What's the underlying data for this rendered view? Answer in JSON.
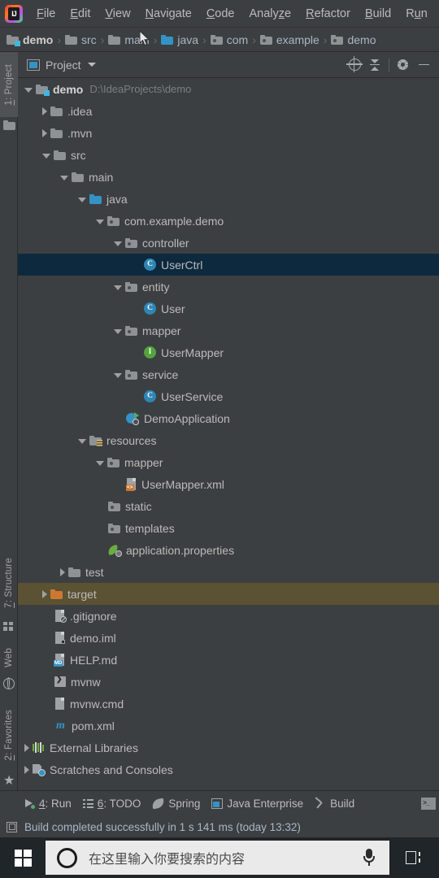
{
  "app": {
    "logo_icon": "intellij-idea-logo",
    "menu": [
      {
        "label": "File",
        "mnemonic": "F"
      },
      {
        "label": "Edit",
        "mnemonic": "E"
      },
      {
        "label": "View",
        "mnemonic": "V"
      },
      {
        "label": "Navigate",
        "mnemonic": "N"
      },
      {
        "label": "Code",
        "mnemonic": "C"
      },
      {
        "label": "Analyze",
        "mnemonic": "z"
      },
      {
        "label": "Refactor",
        "mnemonic": "R"
      },
      {
        "label": "Build",
        "mnemonic": "B"
      },
      {
        "label": "Run",
        "mnemonic": "u"
      }
    ]
  },
  "breadcrumb": {
    "separator": "›",
    "items": [
      {
        "label": "demo",
        "icon": "module-folder-icon",
        "root": true
      },
      {
        "label": "src",
        "icon": "folder-icon"
      },
      {
        "label": "main",
        "icon": "folder-icon"
      },
      {
        "label": "java",
        "icon": "source-root-folder-icon"
      },
      {
        "label": "com",
        "icon": "package-folder-icon"
      },
      {
        "label": "example",
        "icon": "package-folder-icon"
      },
      {
        "label": "demo",
        "icon": "package-folder-icon"
      }
    ]
  },
  "stripe": {
    "left": [
      {
        "label": "1: Project",
        "mnemonic": "1",
        "icon": "project-folder-icon",
        "active": true
      },
      {
        "label": "7: Structure",
        "mnemonic": "7",
        "icon": "structure-icon",
        "active": false
      },
      {
        "label": "Web",
        "mnemonic": "",
        "icon": "web-globe-icon",
        "active": false
      },
      {
        "label": "2: Favorites",
        "mnemonic": "2",
        "icon": "star-icon",
        "active": false
      }
    ]
  },
  "panel": {
    "title": "Project",
    "view_icon": "project-view-icon",
    "dropdown_icon": "chevron-down-icon",
    "tools": [
      {
        "name": "scroll-from-source-icon",
        "title": "Select Opened File"
      },
      {
        "name": "collapse-all-icon",
        "title": "Collapse All"
      },
      {
        "name": "gear-icon",
        "title": "Settings"
      },
      {
        "name": "minimize-icon",
        "title": "Hide"
      }
    ]
  },
  "tree": {
    "rows": [
      {
        "label": "demo",
        "sub": "D:\\IdeaProjects\\demo",
        "indent": 0,
        "arrow": "down",
        "icon": "module-folder-icon",
        "bold": true,
        "state": "normal"
      },
      {
        "label": ".idea",
        "sub": "",
        "indent": 1,
        "arrow": "right",
        "icon": "folder-icon",
        "bold": false,
        "state": "normal"
      },
      {
        "label": ".mvn",
        "sub": "",
        "indent": 1,
        "arrow": "right",
        "icon": "folder-icon",
        "bold": false,
        "state": "normal"
      },
      {
        "label": "src",
        "sub": "",
        "indent": 1,
        "arrow": "down",
        "icon": "folder-icon",
        "bold": false,
        "state": "normal"
      },
      {
        "label": "main",
        "sub": "",
        "indent": 2,
        "arrow": "down",
        "icon": "folder-icon",
        "bold": false,
        "state": "normal"
      },
      {
        "label": "java",
        "sub": "",
        "indent": 3,
        "arrow": "down",
        "icon": "source-root-folder-icon",
        "bold": false,
        "state": "normal"
      },
      {
        "label": "com.example.demo",
        "sub": "",
        "indent": 4,
        "arrow": "down",
        "icon": "package-folder-icon",
        "bold": false,
        "state": "normal"
      },
      {
        "label": "controller",
        "sub": "",
        "indent": 5,
        "arrow": "down",
        "icon": "package-folder-icon",
        "bold": false,
        "state": "normal"
      },
      {
        "label": "UserCtrl",
        "sub": "",
        "indent": 6,
        "arrow": "none",
        "icon": "java-class-icon",
        "bold": false,
        "state": "selected"
      },
      {
        "label": "entity",
        "sub": "",
        "indent": 5,
        "arrow": "down",
        "icon": "package-folder-icon",
        "bold": false,
        "state": "normal"
      },
      {
        "label": "User",
        "sub": "",
        "indent": 6,
        "arrow": "none",
        "icon": "java-class-icon",
        "bold": false,
        "state": "normal"
      },
      {
        "label": "mapper",
        "sub": "",
        "indent": 5,
        "arrow": "down",
        "icon": "package-folder-icon",
        "bold": false,
        "state": "normal"
      },
      {
        "label": "UserMapper",
        "sub": "",
        "indent": 6,
        "arrow": "none",
        "icon": "java-interface-icon",
        "bold": false,
        "state": "normal"
      },
      {
        "label": "service",
        "sub": "",
        "indent": 5,
        "arrow": "down",
        "icon": "package-folder-icon",
        "bold": false,
        "state": "normal"
      },
      {
        "label": "UserService",
        "sub": "",
        "indent": 6,
        "arrow": "none",
        "icon": "java-class-icon",
        "bold": false,
        "state": "normal"
      },
      {
        "label": "DemoApplication",
        "sub": "",
        "indent": 5,
        "arrow": "none",
        "icon": "spring-boot-application-icon",
        "bold": false,
        "state": "normal"
      },
      {
        "label": "resources",
        "sub": "",
        "indent": 3,
        "arrow": "down",
        "icon": "resource-root-folder-icon",
        "bold": false,
        "state": "normal"
      },
      {
        "label": "mapper",
        "sub": "",
        "indent": 4,
        "arrow": "down",
        "icon": "package-folder-icon",
        "bold": false,
        "state": "normal"
      },
      {
        "label": "UserMapper.xml",
        "sub": "",
        "indent": 5,
        "arrow": "none",
        "icon": "xml-file-icon",
        "bold": false,
        "state": "normal"
      },
      {
        "label": "static",
        "sub": "",
        "indent": 4,
        "arrow": "none",
        "icon": "package-folder-icon",
        "bold": false,
        "state": "normal"
      },
      {
        "label": "templates",
        "sub": "",
        "indent": 4,
        "arrow": "none",
        "icon": "package-folder-icon",
        "bold": false,
        "state": "normal"
      },
      {
        "label": "application.properties",
        "sub": "",
        "indent": 4,
        "arrow": "none",
        "icon": "spring-properties-icon",
        "bold": false,
        "state": "normal"
      },
      {
        "label": "test",
        "sub": "",
        "indent": 2,
        "arrow": "right",
        "icon": "folder-icon",
        "bold": false,
        "state": "normal"
      },
      {
        "label": "target",
        "sub": "",
        "indent": 1,
        "arrow": "right",
        "icon": "excluded-folder-icon",
        "bold": false,
        "state": "highlighted"
      },
      {
        "label": ".gitignore",
        "sub": "",
        "indent": 1,
        "arrow": "none",
        "icon": "gitignore-file-icon",
        "bold": false,
        "state": "normal"
      },
      {
        "label": "demo.iml",
        "sub": "",
        "indent": 1,
        "arrow": "none",
        "icon": "iml-file-icon",
        "bold": false,
        "state": "normal"
      },
      {
        "label": "HELP.md",
        "sub": "",
        "indent": 1,
        "arrow": "none",
        "icon": "markdown-file-icon",
        "bold": false,
        "state": "normal"
      },
      {
        "label": "mvnw",
        "sub": "",
        "indent": 1,
        "arrow": "none",
        "icon": "shell-script-icon",
        "bold": false,
        "state": "normal"
      },
      {
        "label": "mvnw.cmd",
        "sub": "",
        "indent": 1,
        "arrow": "none",
        "icon": "text-file-icon",
        "bold": false,
        "state": "normal"
      },
      {
        "label": "pom.xml",
        "sub": "",
        "indent": 1,
        "arrow": "none",
        "icon": "maven-pom-icon",
        "bold": false,
        "state": "normal"
      },
      {
        "label": "External Libraries",
        "sub": "",
        "indent": 0,
        "arrow": "right",
        "icon": "external-libraries-icon",
        "bold": false,
        "state": "normal"
      },
      {
        "label": "Scratches and Consoles",
        "sub": "",
        "indent": 0,
        "arrow": "right",
        "icon": "scratches-icon",
        "bold": false,
        "state": "normal"
      }
    ]
  },
  "bottom_bar": {
    "buttons": [
      {
        "label": "4: Run",
        "mnemonic": "4",
        "icon": "run-icon"
      },
      {
        "label": "6: TODO",
        "mnemonic": "6",
        "icon": "todo-list-icon"
      },
      {
        "label": "Spring",
        "mnemonic": "",
        "icon": "spring-leaf-icon"
      },
      {
        "label": "Java Enterprise",
        "mnemonic": "",
        "icon": "java-enterprise-icon"
      },
      {
        "label": "Build",
        "mnemonic": "",
        "icon": "build-hammer-icon"
      }
    ],
    "right_button": {
      "label": "",
      "icon": "terminal-icon"
    }
  },
  "status_bar": {
    "icon": "event-log-icon",
    "text": "Build completed successfully in 1 s 141 ms (today 13:32)"
  },
  "taskbar": {
    "start_icon": "windows-start-icon",
    "cortana_icon": "cortana-circle-icon",
    "search_placeholder": "在这里输入你要搜索的内容",
    "mic_icon": "microphone-icon",
    "taskview_icon": "task-view-icon"
  },
  "colors": {
    "bg": "#3c3f41",
    "selection": "#0d293e",
    "highlight": "#5b5133",
    "text": "#bbbbbb",
    "accent": "#3592c4"
  }
}
